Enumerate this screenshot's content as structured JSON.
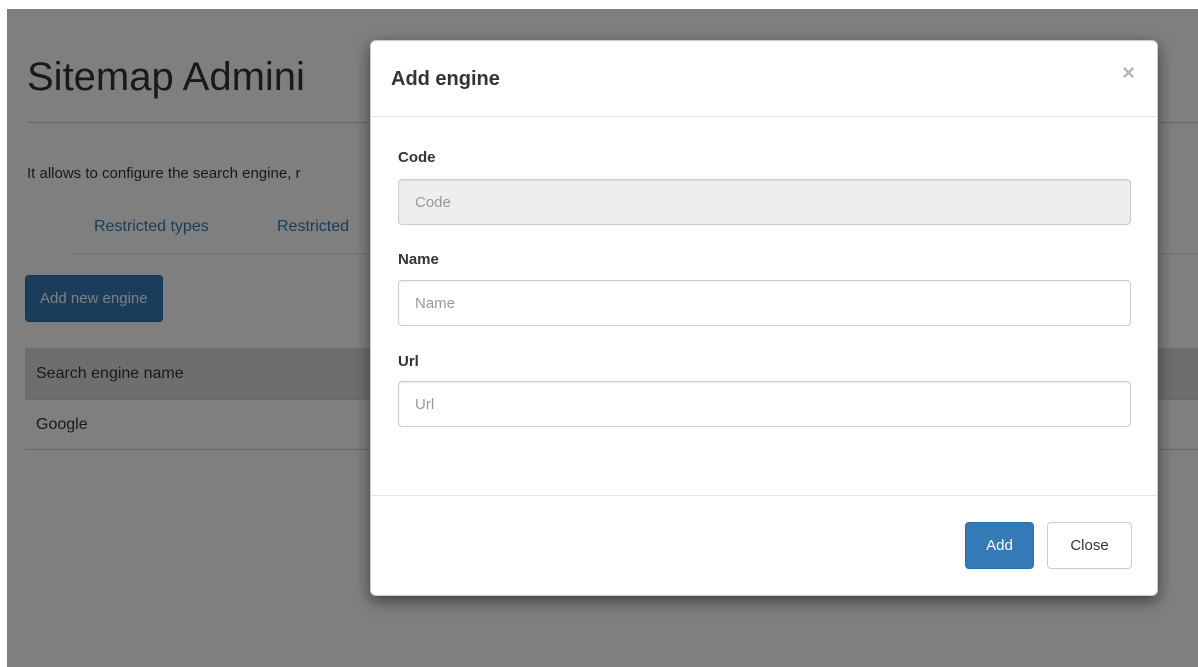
{
  "page": {
    "title": "Sitemap Admini",
    "description": "It allows to configure the search engine, r",
    "tabs": [
      {
        "label": "Restricted types"
      },
      {
        "label": "Restricted"
      }
    ],
    "add_new_button": "Add new engine",
    "table": {
      "header": "Search engine name",
      "rows": [
        {
          "name": "Google"
        }
      ]
    }
  },
  "modal": {
    "title": "Add engine",
    "close_glyph": "×",
    "fields": {
      "code": {
        "label": "Code",
        "placeholder": "Code",
        "value": ""
      },
      "name": {
        "label": "Name",
        "placeholder": "Name",
        "value": ""
      },
      "url": {
        "label": "Url",
        "placeholder": "Url",
        "value": ""
      }
    },
    "buttons": {
      "add": "Add",
      "close": "Close"
    }
  },
  "colors": {
    "primary": "#337ab7",
    "link": "#337ab7",
    "backdrop": "rgba(0,0,0,0.5)"
  }
}
